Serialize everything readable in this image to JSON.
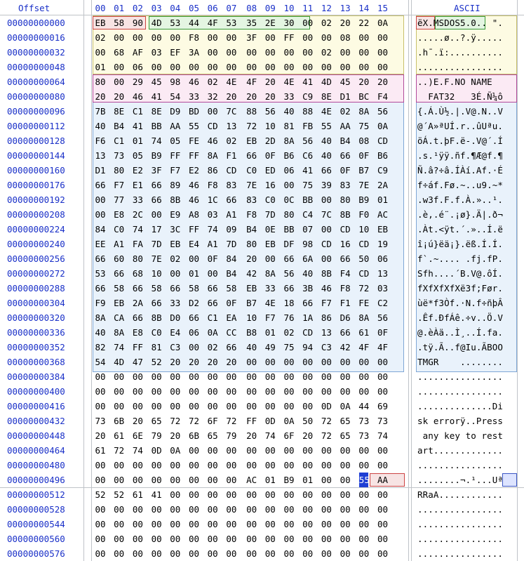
{
  "header": {
    "offset_label": "Offset",
    "ascii_label": "ASCII",
    "columns": [
      "00",
      "01",
      "02",
      "03",
      "04",
      "05",
      "06",
      "07",
      "08",
      "09",
      "10",
      "11",
      "12",
      "13",
      "14",
      "15"
    ]
  },
  "rows": [
    {
      "offset": "00000000000",
      "bytes": [
        "EB",
        "58",
        "90",
        "4D",
        "53",
        "44",
        "4F",
        "53",
        "35",
        "2E",
        "30",
        "00",
        "02",
        "20",
        "22",
        "0A"
      ],
      "ascii": "ëX.MSDOS5.0.. \"."
    },
    {
      "offset": "00000000016",
      "bytes": [
        "02",
        "00",
        "00",
        "00",
        "00",
        "F8",
        "00",
        "00",
        "3F",
        "00",
        "FF",
        "00",
        "00",
        "08",
        "00",
        "00"
      ],
      "ascii": ".....ø..?.ÿ....."
    },
    {
      "offset": "00000000032",
      "bytes": [
        "00",
        "68",
        "AF",
        "03",
        "EF",
        "3A",
        "00",
        "00",
        "00",
        "00",
        "00",
        "00",
        "02",
        "00",
        "00",
        "00"
      ],
      "ascii": ".h¯.ï:.........."
    },
    {
      "offset": "00000000048",
      "bytes": [
        "01",
        "00",
        "06",
        "00",
        "00",
        "00",
        "00",
        "00",
        "00",
        "00",
        "00",
        "00",
        "00",
        "00",
        "00",
        "00"
      ],
      "ascii": "................"
    },
    {
      "offset": "00000000064",
      "bytes": [
        "80",
        "00",
        "29",
        "45",
        "98",
        "46",
        "02",
        "4E",
        "4F",
        "20",
        "4E",
        "41",
        "4D",
        "45",
        "20",
        "20"
      ],
      "ascii": "..)E.F.NO NAME  "
    },
    {
      "offset": "00000000080",
      "bytes": [
        "20",
        "20",
        "46",
        "41",
        "54",
        "33",
        "32",
        "20",
        "20",
        "20",
        "33",
        "C9",
        "8E",
        "D1",
        "BC",
        "F4"
      ],
      "ascii": "  FAT32   3É.Ñ¼ô"
    },
    {
      "offset": "00000000096",
      "bytes": [
        "7B",
        "8E",
        "C1",
        "8E",
        "D9",
        "BD",
        "00",
        "7C",
        "88",
        "56",
        "40",
        "88",
        "4E",
        "02",
        "8A",
        "56"
      ],
      "ascii": "{.Á.Ù½.|.V@.N..V"
    },
    {
      "offset": "00000000112",
      "bytes": [
        "40",
        "B4",
        "41",
        "BB",
        "AA",
        "55",
        "CD",
        "13",
        "72",
        "10",
        "81",
        "FB",
        "55",
        "AA",
        "75",
        "0A"
      ],
      "ascii": "@´A»ªUÍ.r..ûUªu."
    },
    {
      "offset": "00000000128",
      "bytes": [
        "F6",
        "C1",
        "01",
        "74",
        "05",
        "FE",
        "46",
        "02",
        "EB",
        "2D",
        "8A",
        "56",
        "40",
        "B4",
        "08",
        "CD"
      ],
      "ascii": "öÁ.t.þF.ë-.V@´.Í"
    },
    {
      "offset": "00000000144",
      "bytes": [
        "13",
        "73",
        "05",
        "B9",
        "FF",
        "FF",
        "8A",
        "F1",
        "66",
        "0F",
        "B6",
        "C6",
        "40",
        "66",
        "0F",
        "B6"
      ],
      "ascii": ".s.¹ÿÿ.ñf.¶Æ@f.¶"
    },
    {
      "offset": "00000000160",
      "bytes": [
        "D1",
        "80",
        "E2",
        "3F",
        "F7",
        "E2",
        "86",
        "CD",
        "C0",
        "ED",
        "06",
        "41",
        "66",
        "0F",
        "B7",
        "C9"
      ],
      "ascii": "Ñ.â?÷â.ÍÀí.Af.·É"
    },
    {
      "offset": "00000000176",
      "bytes": [
        "66",
        "F7",
        "E1",
        "66",
        "89",
        "46",
        "F8",
        "83",
        "7E",
        "16",
        "00",
        "75",
        "39",
        "83",
        "7E",
        "2A"
      ],
      "ascii": "f÷áf.Fø.~..u9.~*"
    },
    {
      "offset": "00000000192",
      "bytes": [
        "00",
        "77",
        "33",
        "66",
        "8B",
        "46",
        "1C",
        "66",
        "83",
        "C0",
        "0C",
        "BB",
        "00",
        "80",
        "B9",
        "01"
      ],
      "ascii": ".w3f.F.f.À.»..¹."
    },
    {
      "offset": "00000000208",
      "bytes": [
        "00",
        "E8",
        "2C",
        "00",
        "E9",
        "A8",
        "03",
        "A1",
        "F8",
        "7D",
        "80",
        "C4",
        "7C",
        "8B",
        "F0",
        "AC"
      ],
      "ascii": ".è,.é¨.¡ø}.Ä|.ð¬"
    },
    {
      "offset": "00000000224",
      "bytes": [
        "84",
        "C0",
        "74",
        "17",
        "3C",
        "FF",
        "74",
        "09",
        "B4",
        "0E",
        "BB",
        "07",
        "00",
        "CD",
        "10",
        "EB"
      ],
      "ascii": ".Àt.<ÿt.´.»..Í.ë"
    },
    {
      "offset": "00000000240",
      "bytes": [
        "EE",
        "A1",
        "FA",
        "7D",
        "EB",
        "E4",
        "A1",
        "7D",
        "80",
        "EB",
        "DF",
        "98",
        "CD",
        "16",
        "CD",
        "19"
      ],
      "ascii": "î¡ú}ëä¡}.ëß.Í.Í."
    },
    {
      "offset": "00000000256",
      "bytes": [
        "66",
        "60",
        "80",
        "7E",
        "02",
        "00",
        "0F",
        "84",
        "20",
        "00",
        "66",
        "6A",
        "00",
        "66",
        "50",
        "06"
      ],
      "ascii": "f`.~.... .fj.fP."
    },
    {
      "offset": "00000000272",
      "bytes": [
        "53",
        "66",
        "68",
        "10",
        "00",
        "01",
        "00",
        "B4",
        "42",
        "8A",
        "56",
        "40",
        "8B",
        "F4",
        "CD",
        "13"
      ],
      "ascii": "Sfh....´B.V@.ôÍ."
    },
    {
      "offset": "00000000288",
      "bytes": [
        "66",
        "58",
        "66",
        "58",
        "66",
        "58",
        "66",
        "58",
        "EB",
        "33",
        "66",
        "3B",
        "46",
        "F8",
        "72",
        "03"
      ],
      "ascii": "fXfXfXfXë3f;Før."
    },
    {
      "offset": "00000000304",
      "bytes": [
        "F9",
        "EB",
        "2A",
        "66",
        "33",
        "D2",
        "66",
        "0F",
        "B7",
        "4E",
        "18",
        "66",
        "F7",
        "F1",
        "FE",
        "C2"
      ],
      "ascii": "ùë*f3Òf.·N.f÷ñþÂ"
    },
    {
      "offset": "00000000320",
      "bytes": [
        "8A",
        "CA",
        "66",
        "8B",
        "D0",
        "66",
        "C1",
        "EA",
        "10",
        "F7",
        "76",
        "1A",
        "86",
        "D6",
        "8A",
        "56"
      ],
      "ascii": ".Êf.ÐfÁê.÷v..Ö.V"
    },
    {
      "offset": "00000000336",
      "bytes": [
        "40",
        "8A",
        "E8",
        "C0",
        "E4",
        "06",
        "0A",
        "CC",
        "B8",
        "01",
        "02",
        "CD",
        "13",
        "66",
        "61",
        "0F"
      ],
      "ascii": "@.èÀä..Ì¸..Í.fa."
    },
    {
      "offset": "00000000352",
      "bytes": [
        "82",
        "74",
        "FF",
        "81",
        "C3",
        "00",
        "02",
        "66",
        "40",
        "49",
        "75",
        "94",
        "C3",
        "42",
        "4F",
        "4F"
      ],
      "ascii": ".tÿ.Ã..f@Iu.ÃBOO"
    },
    {
      "offset": "00000000368",
      "bytes": [
        "54",
        "4D",
        "47",
        "52",
        "20",
        "20",
        "20",
        "20",
        "00",
        "00",
        "00",
        "00",
        "00",
        "00",
        "00",
        "00"
      ],
      "ascii": "TMGR    ........"
    },
    {
      "offset": "00000000384",
      "bytes": [
        "00",
        "00",
        "00",
        "00",
        "00",
        "00",
        "00",
        "00",
        "00",
        "00",
        "00",
        "00",
        "00",
        "00",
        "00",
        "00"
      ],
      "ascii": "................"
    },
    {
      "offset": "00000000400",
      "bytes": [
        "00",
        "00",
        "00",
        "00",
        "00",
        "00",
        "00",
        "00",
        "00",
        "00",
        "00",
        "00",
        "00",
        "00",
        "00",
        "00"
      ],
      "ascii": "................"
    },
    {
      "offset": "00000000416",
      "bytes": [
        "00",
        "00",
        "00",
        "00",
        "00",
        "00",
        "00",
        "00",
        "00",
        "00",
        "00",
        "00",
        "0D",
        "0A",
        "44",
        "69"
      ],
      "ascii": "..............Di"
    },
    {
      "offset": "00000000432",
      "bytes": [
        "73",
        "6B",
        "20",
        "65",
        "72",
        "72",
        "6F",
        "72",
        "FF",
        "0D",
        "0A",
        "50",
        "72",
        "65",
        "73",
        "73"
      ],
      "ascii": "sk errorÿ..Press"
    },
    {
      "offset": "00000000448",
      "bytes": [
        "20",
        "61",
        "6E",
        "79",
        "20",
        "6B",
        "65",
        "79",
        "20",
        "74",
        "6F",
        "20",
        "72",
        "65",
        "73",
        "74"
      ],
      "ascii": " any key to rest"
    },
    {
      "offset": "00000000464",
      "bytes": [
        "61",
        "72",
        "74",
        "0D",
        "0A",
        "00",
        "00",
        "00",
        "00",
        "00",
        "00",
        "00",
        "00",
        "00",
        "00",
        "00"
      ],
      "ascii": "art............."
    },
    {
      "offset": "00000000480",
      "bytes": [
        "00",
        "00",
        "00",
        "00",
        "00",
        "00",
        "00",
        "00",
        "00",
        "00",
        "00",
        "00",
        "00",
        "00",
        "00",
        "00"
      ],
      "ascii": "................"
    },
    {
      "offset": "00000000496",
      "bytes": [
        "00",
        "00",
        "00",
        "00",
        "00",
        "00",
        "00",
        "00",
        "AC",
        "01",
        "B9",
        "01",
        "00",
        "00",
        "55",
        "AA"
      ],
      "ascii": "........¬.¹...Uª"
    },
    {
      "offset": "00000000512",
      "bytes": [
        "52",
        "52",
        "61",
        "41",
        "00",
        "00",
        "00",
        "00",
        "00",
        "00",
        "00",
        "00",
        "00",
        "00",
        "00",
        "00"
      ],
      "ascii": "RRaA............"
    },
    {
      "offset": "00000000528",
      "bytes": [
        "00",
        "00",
        "00",
        "00",
        "00",
        "00",
        "00",
        "00",
        "00",
        "00",
        "00",
        "00",
        "00",
        "00",
        "00",
        "00"
      ],
      "ascii": "................"
    },
    {
      "offset": "00000000544",
      "bytes": [
        "00",
        "00",
        "00",
        "00",
        "00",
        "00",
        "00",
        "00",
        "00",
        "00",
        "00",
        "00",
        "00",
        "00",
        "00",
        "00"
      ],
      "ascii": "................"
    },
    {
      "offset": "00000000560",
      "bytes": [
        "00",
        "00",
        "00",
        "00",
        "00",
        "00",
        "00",
        "00",
        "00",
        "00",
        "00",
        "00",
        "00",
        "00",
        "00",
        "00"
      ],
      "ascii": "................"
    },
    {
      "offset": "00000000576",
      "bytes": [
        "00",
        "00",
        "00",
        "00",
        "00",
        "00",
        "00",
        "00",
        "00",
        "00",
        "00",
        "00",
        "00",
        "00",
        "00",
        "00"
      ],
      "ascii": "................"
    }
  ],
  "colors": {
    "offset_text": "#1a30c8",
    "grid": "#bfc3c8",
    "selection": "#1f3fd4"
  }
}
